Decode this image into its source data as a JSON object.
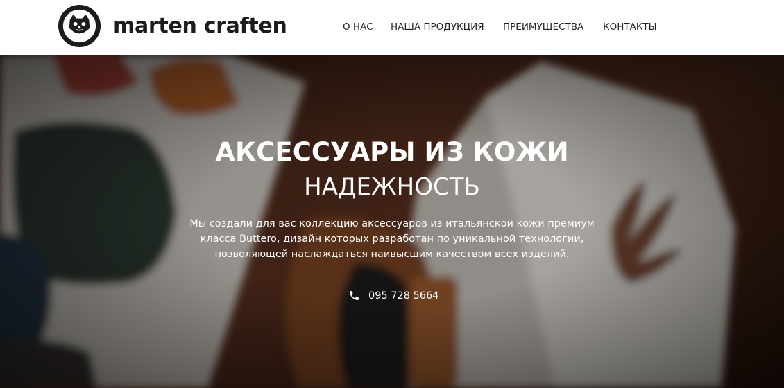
{
  "header": {
    "logo_text": "MARTEN CRAFTEN",
    "brand": "marten craften",
    "nav": [
      {
        "label": "О НАС"
      },
      {
        "label": "НАША ПРОДУКЦИЯ"
      },
      {
        "label": "ПРЕИМУЩЕСТВА"
      },
      {
        "label": "КОНТАКТЫ"
      }
    ]
  },
  "hero": {
    "title": "АКСЕССУАРЫ ИЗ КОЖИ",
    "subtitle": "НАДЕЖНОСТЬ",
    "description_lines": [
      "Мы создали для вас коллекцию аксессуаров из итальянской кожи премиум",
      "класса Buttero, дизайн которых разработан по уникальной технологии,",
      "позволяющей наслаждаться наивысшим качеством всех изделий."
    ],
    "phone_icon": "phone-icon",
    "phone": "095 728 5664"
  }
}
